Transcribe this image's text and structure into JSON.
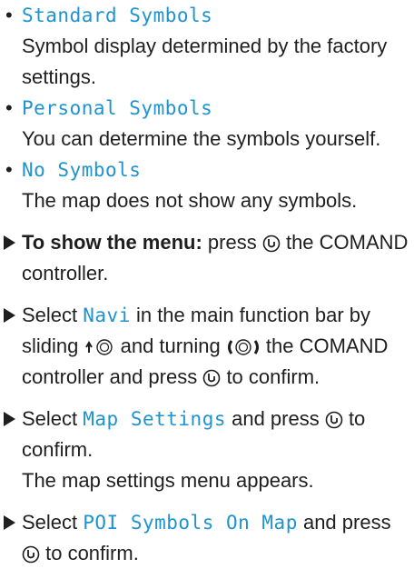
{
  "options": [
    {
      "term": "Standard Symbols",
      "desc": "Symbol display determined by the factory settings."
    },
    {
      "term": "Personal Symbols",
      "desc": "You can determine the symbols yourself."
    },
    {
      "term": "No Symbols",
      "desc": "The map does not show any symbols."
    }
  ],
  "steps": {
    "s1": {
      "bold": "To show the menu:",
      "t1": " press ",
      "t2": " the COMAND controller."
    },
    "s2": {
      "t1": "Select ",
      "term": "Navi",
      "t2": " in the main function bar by sliding ",
      "t3": " and turning ",
      "t4": " the COMAND controller and press ",
      "t5": " to confirm."
    },
    "s3": {
      "t1": "Select ",
      "term": "Map Settings",
      "t2": " and press ",
      "t3": " to confirm.",
      "t4": "The map settings menu appears."
    },
    "s4": {
      "t1": "Select ",
      "term": "POI Symbols On Map",
      "t2": " and press ",
      "t3": " to confirm."
    }
  },
  "icons": [
    "press-controller-icon",
    "slide-up-icon",
    "turn-controller-icon"
  ]
}
